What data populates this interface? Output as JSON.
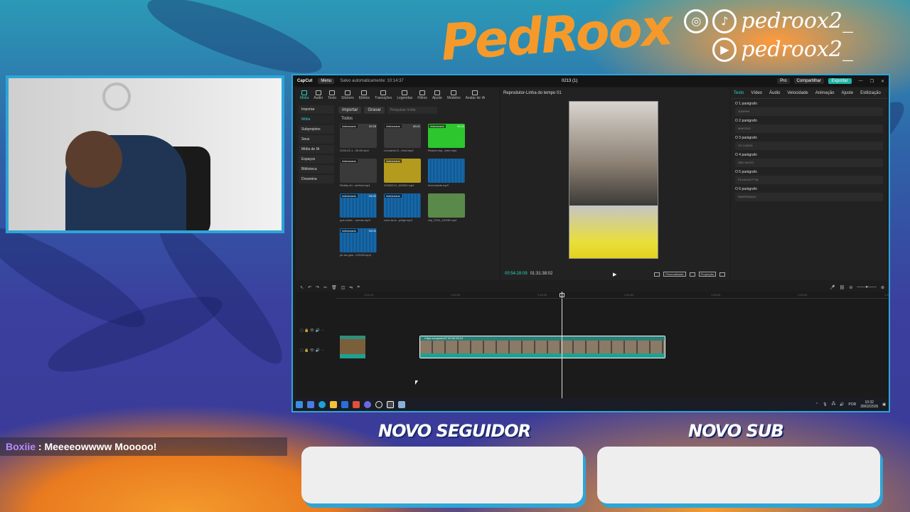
{
  "overlay": {
    "title": "PedRoox",
    "social_handle_1": "pedroox2_",
    "social_handle_2": "pedroox2_",
    "instagram_icon": "instagram-icon",
    "tiktok_icon": "tiktok-icon",
    "youtube_icon": "youtube-icon"
  },
  "chat": {
    "user": "Boxiie",
    "separator": " : ",
    "message": "Meeeeowwww Mooooo!"
  },
  "notifications": {
    "follower_title": "NOVO SEGUIDOR",
    "sub_title": "NOVO SUB"
  },
  "app": {
    "brand": "CapCut",
    "menu": "Menu",
    "saved": "Salvo automaticamente: 10:14:37",
    "project": "0213 (1)",
    "pro": "Pro",
    "share": "Compartilhar",
    "export": "Exportar",
    "tools": [
      "Mídia",
      "Áudio",
      "Texto",
      "Stickers",
      "Efeitos",
      "Transições",
      "Legendas",
      "Filtros",
      "Ajuste",
      "Modelos",
      "Avatar de IA"
    ],
    "left_nav": [
      "Importar",
      "Mídia",
      "Subprojetos",
      "Seus",
      "Mídia de IA",
      "Espaços",
      "Biblioteca",
      "Dreamina"
    ],
    "import_btn": "Importar",
    "record_btn": "Gravar",
    "search_placeholder": "Pesquisar mídia",
    "all_label": "Todos",
    "media": [
      {
        "tag": "Adicionado",
        "dur": "22:25",
        "name": "2026-02-1...05-56.mp4",
        "kind": "video"
      },
      {
        "tag": "Adicionado",
        "dur": "00:21",
        "name": "Leonardo D...rtical.mp4",
        "kind": "video"
      },
      {
        "tag": "Adicionado",
        "dur": "00:11",
        "name": "Reacts esp...dren.mp4",
        "kind": "green"
      },
      {
        "tag": "Adicionado",
        "dur": "",
        "name": "Reality sh...vertical.mp4",
        "kind": "video"
      },
      {
        "tag": "Adicionado",
        "dur": "",
        "name": "20250213_163004.mp4",
        "kind": "yellow"
      },
      {
        "tag": "",
        "dur": "",
        "name": "Imm-hands.mp3",
        "kind": "audio"
      },
      {
        "tag": "Adicionado",
        "dur": "00:22",
        "name": "que-vocie-...osmax.mp3",
        "kind": "audio"
      },
      {
        "tag": "Adicionado",
        "dur": "",
        "name": "voce-ta-fu...pelge.mp3",
        "kind": "audio"
      },
      {
        "tag": "",
        "dur": "",
        "name": "clip_STAL_04239.mp4",
        "kind": "field"
      },
      {
        "tag": "Adicionado",
        "dur": "00:01",
        "name": "pri-do-gols...IV2025.mp3",
        "kind": "audio"
      }
    ],
    "player_title": "Reprodutor-Linha do tempo 01",
    "timecode_current": "00:54:28:09",
    "timecode_total": "01:31:38:02",
    "player_option_1": "Personalizado",
    "player_option_2": "Proporção",
    "prop_tabs": [
      "Texto",
      "Vídeo",
      "Áudio",
      "Velocidade",
      "Animação",
      "Ajuste",
      "Estilização"
    ],
    "paragraphs": [
      {
        "label": "O 1 parágrafo",
        "value": "JUNHHH"
      },
      {
        "label": "O 2 parágrafo",
        "value": "MAKODO"
      },
      {
        "label": "O 3 parágrafo",
        "value": "OS CARAS"
      },
      {
        "label": "O 4 parágrafo",
        "value": "SÃO MUITO"
      },
      {
        "label": "O 5 parágrafo",
        "value": "FILHA DA P**@"
      },
      {
        "label": "O 6 parágrafo",
        "value": "NAMORAAAL!"
      }
    ],
    "ruler": [
      "1:44:10",
      "1:44:20",
      "1:44:30",
      "1:44:40",
      "1:44:50",
      "1:45:00",
      "1:45:10"
    ],
    "clip_label": "Clipe composto27  00:00:33:12"
  },
  "taskbar": {
    "lang": "POR",
    "time": "10:32",
    "date": "28/02/2026"
  }
}
